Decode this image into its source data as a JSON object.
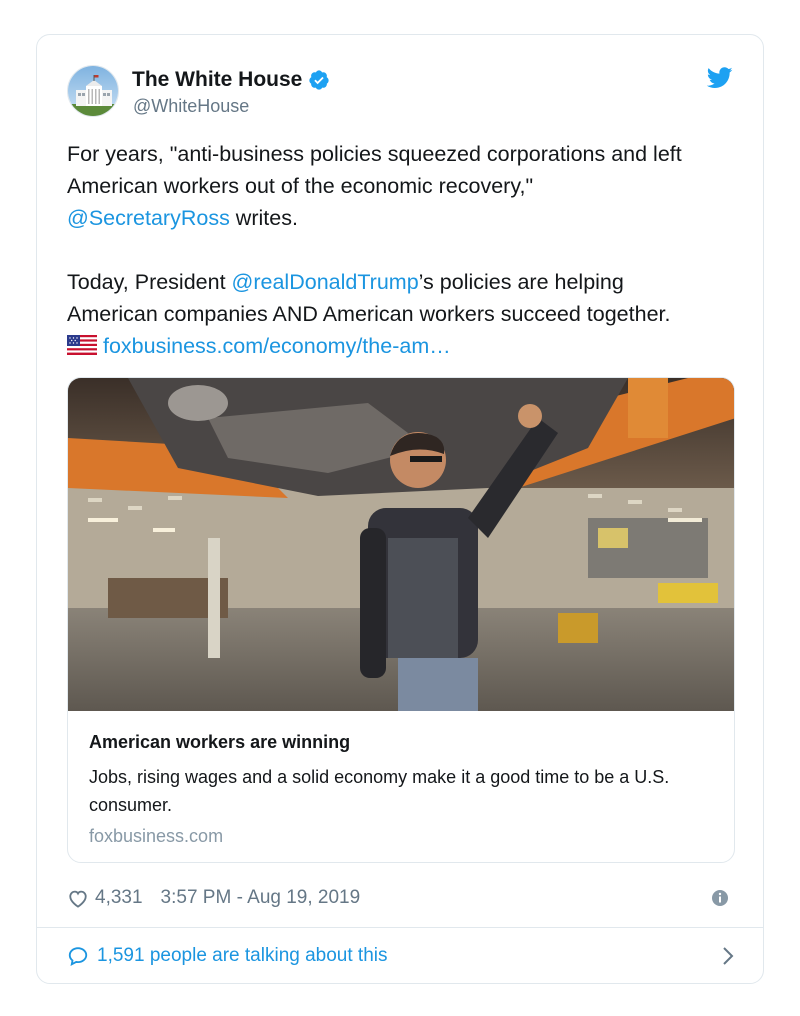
{
  "tweet": {
    "author_name": "The White House",
    "author_handle": "@WhiteHouse",
    "text": {
      "line1": "For years, \"anti-business policies squeezed corporations and left",
      "line2": "American workers out of the economic recovery,\"",
      "mention_ross": "@SecretaryRoss",
      "line3_rest": " writes.",
      "line4_pre": "Today, President ",
      "mention_trump": "@realDonaldTrump",
      "line4_rest": "’s policies are helping",
      "line5": "American companies AND American workers succeed together.",
      "link": "foxbusiness.com/economy/the-am…"
    },
    "card": {
      "title": "American workers are winning",
      "description": "Jobs, rising wages and a solid economy make it a good time to be a U.S. consumer.",
      "domain": "foxbusiness.com"
    },
    "likes": "4,331",
    "timestamp": "3:57 PM - Aug 19, 2019",
    "talking": "1,591 people are talking about this"
  },
  "colors": {
    "link": "#1b95e0",
    "text": "#14171a",
    "muted": "#657786",
    "border": "#e1e8ed"
  },
  "icons": [
    "white-house-avatar",
    "verified-badge-icon",
    "twitter-bird-icon",
    "us-flag-icon",
    "heart-icon",
    "info-icon",
    "comment-icon",
    "chevron-right-icon"
  ]
}
